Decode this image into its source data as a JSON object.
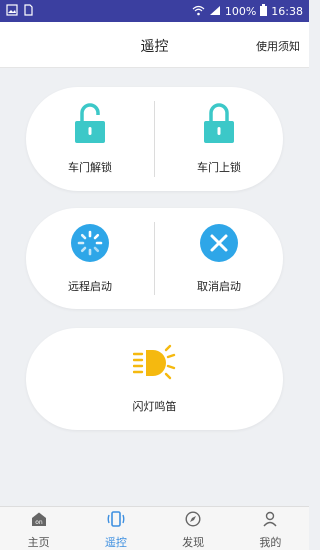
{
  "status_bar": {
    "battery": "100%",
    "time": "16:38"
  },
  "header": {
    "title": "遥控",
    "notice": "使用须知"
  },
  "controls": {
    "unlock": "车门解锁",
    "lock": "车门上锁",
    "remote_start": "远程启动",
    "cancel_start": "取消启动",
    "flash_honk": "闪灯鸣笛"
  },
  "tabs": [
    {
      "label": "主页",
      "icon": "home-icon"
    },
    {
      "label": "遥控",
      "icon": "remote-icon"
    },
    {
      "label": "发现",
      "icon": "compass-icon"
    },
    {
      "label": "我的",
      "icon": "user-icon"
    }
  ],
  "colors": {
    "lock_teal": "#3cc8c8",
    "blue_button": "#2ea6e8",
    "flash_yellow": "#f5b90f",
    "active_tab": "#3d8fe0",
    "status_bar": "#3b3fa0"
  }
}
